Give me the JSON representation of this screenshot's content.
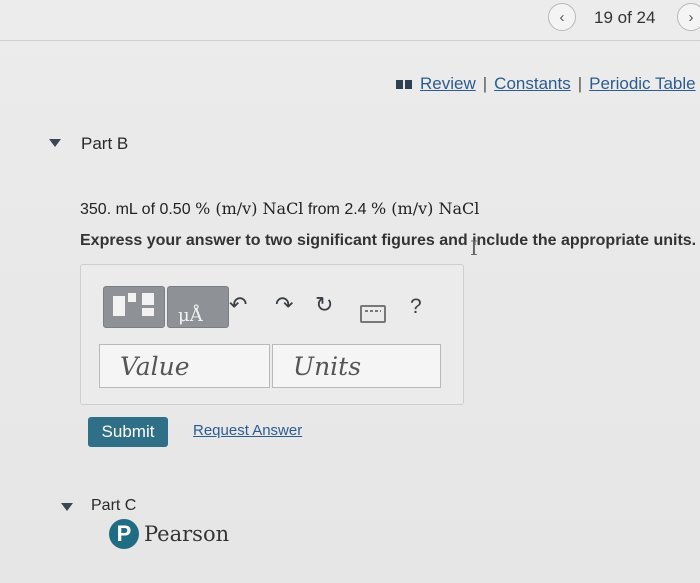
{
  "nav": {
    "prev_icon": "‹",
    "next_icon": "›",
    "counter": "19 of 24"
  },
  "resources": {
    "icon": "book-icon",
    "review": "Review",
    "constants": "Constants",
    "periodic_table": "Periodic Table",
    "separator": "|"
  },
  "part_b": {
    "label": "Part B",
    "problem_volume": "350. mL",
    "problem_of": "of 0.50",
    "problem_unit1": "% (m/v) NaCl",
    "problem_from": "from 2.4",
    "problem_unit2": "% (m/v) NaCl",
    "instruction": "Express your answer to two significant figures and include the appropriate units."
  },
  "toolbar": {
    "units_text": "μÅ",
    "undo_icon": "↶",
    "redo_icon": "↷",
    "reset_icon": "↻",
    "help": "?"
  },
  "answer": {
    "value_placeholder": "Value",
    "units_placeholder": "Units"
  },
  "actions": {
    "submit": "Submit",
    "request_answer": "Request Answer"
  },
  "part_c": {
    "label": "Part C"
  },
  "brand": {
    "logo_letter": "P",
    "name": "Pearson",
    "color": "#1f6c84"
  }
}
